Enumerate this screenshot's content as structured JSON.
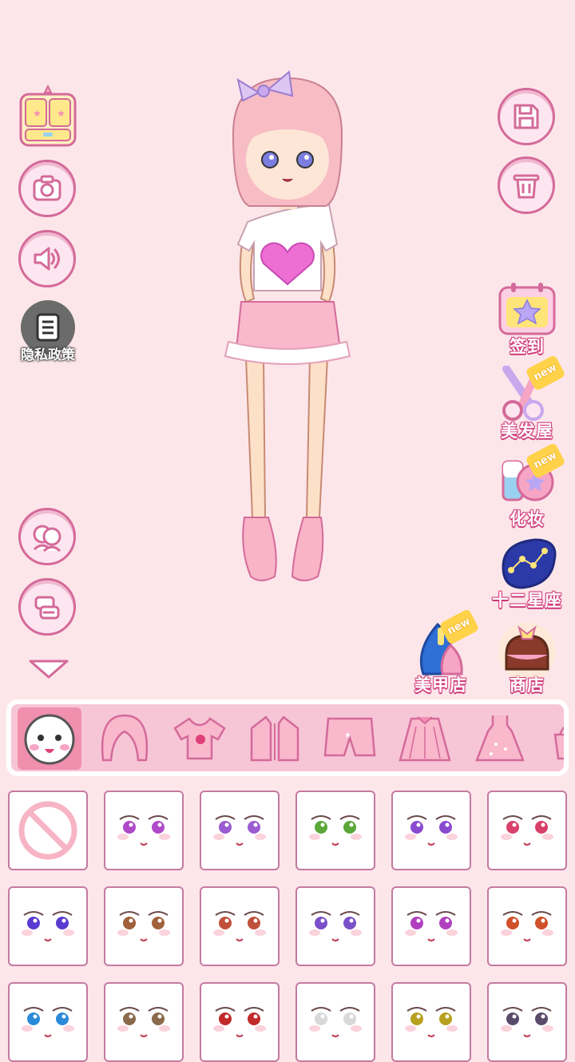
{
  "left_toolbar": {
    "wardrobe_icon": "wardrobe-icon",
    "camera_icon": "camera-icon",
    "sound_icon": "speaker-icon",
    "privacy": {
      "icon": "document-icon",
      "label": "隐私政策"
    },
    "faces_icon": "faces-icon",
    "swap_icon": "swap-icon",
    "collapse_icon": "chevron-down-icon"
  },
  "right_toolbar": {
    "save_icon": "save-icon",
    "delete_icon": "trash-icon",
    "features": [
      {
        "label": "签到",
        "icon": "calendar-icon",
        "new": ""
      },
      {
        "label": "美发屋",
        "icon": "scissors-icon",
        "new": "new"
      },
      {
        "label": "化妆",
        "icon": "makeup-icon",
        "new": "new"
      },
      {
        "label": "十二星座",
        "icon": "constellation-icon",
        "new": ""
      }
    ],
    "bottom_features": [
      {
        "label": "美甲店",
        "icon": "nail-polish-icon",
        "new": "new"
      },
      {
        "label": "商店",
        "icon": "shop-bag-icon",
        "new": ""
      }
    ]
  },
  "categories": [
    {
      "name": "face",
      "icon": "face-icon",
      "selected": true
    },
    {
      "name": "hair",
      "icon": "hair-icon",
      "selected": false
    },
    {
      "name": "top",
      "icon": "tshirt-icon",
      "selected": false
    },
    {
      "name": "jacket",
      "icon": "jacket-icon",
      "selected": false
    },
    {
      "name": "shorts",
      "icon": "shorts-icon",
      "selected": false
    },
    {
      "name": "skirt",
      "icon": "skirt-icon",
      "selected": false
    },
    {
      "name": "dress",
      "icon": "dress-icon",
      "selected": false
    },
    {
      "name": "accessory",
      "icon": "bag-icon",
      "selected": false
    }
  ],
  "colors": {
    "background": "#fde6ea",
    "accent": "#d46a9a",
    "category_bar": "#f7c6d6",
    "category_active": "#f08fae"
  },
  "face_options": [
    {
      "type": "none",
      "eye": "",
      "selected": false
    },
    {
      "type": "face",
      "eye": "#b04ac8"
    },
    {
      "type": "face",
      "eye": "#9a5cd0"
    },
    {
      "type": "face",
      "eye": "#5aa83a"
    },
    {
      "type": "face",
      "eye": "#8a4ad0"
    },
    {
      "type": "face",
      "eye": "#d8406a"
    },
    {
      "type": "face",
      "eye": "#5a3ad0"
    },
    {
      "type": "face",
      "eye": "#a0603a"
    },
    {
      "type": "face",
      "eye": "#c0503a"
    },
    {
      "type": "face",
      "eye": "#7a50c8"
    },
    {
      "type": "face",
      "eye": "#b040c0"
    },
    {
      "type": "face",
      "eye": "#d0502a"
    },
    {
      "type": "face",
      "eye": "#2a8ad8"
    },
    {
      "type": "face",
      "eye": "#8a6a4a"
    },
    {
      "type": "face",
      "eye": "#c02a2a"
    },
    {
      "type": "face",
      "eye": ""
    },
    {
      "type": "face",
      "eye": "#b8a020"
    },
    {
      "type": "face",
      "eye": "#5a4a6a"
    }
  ]
}
